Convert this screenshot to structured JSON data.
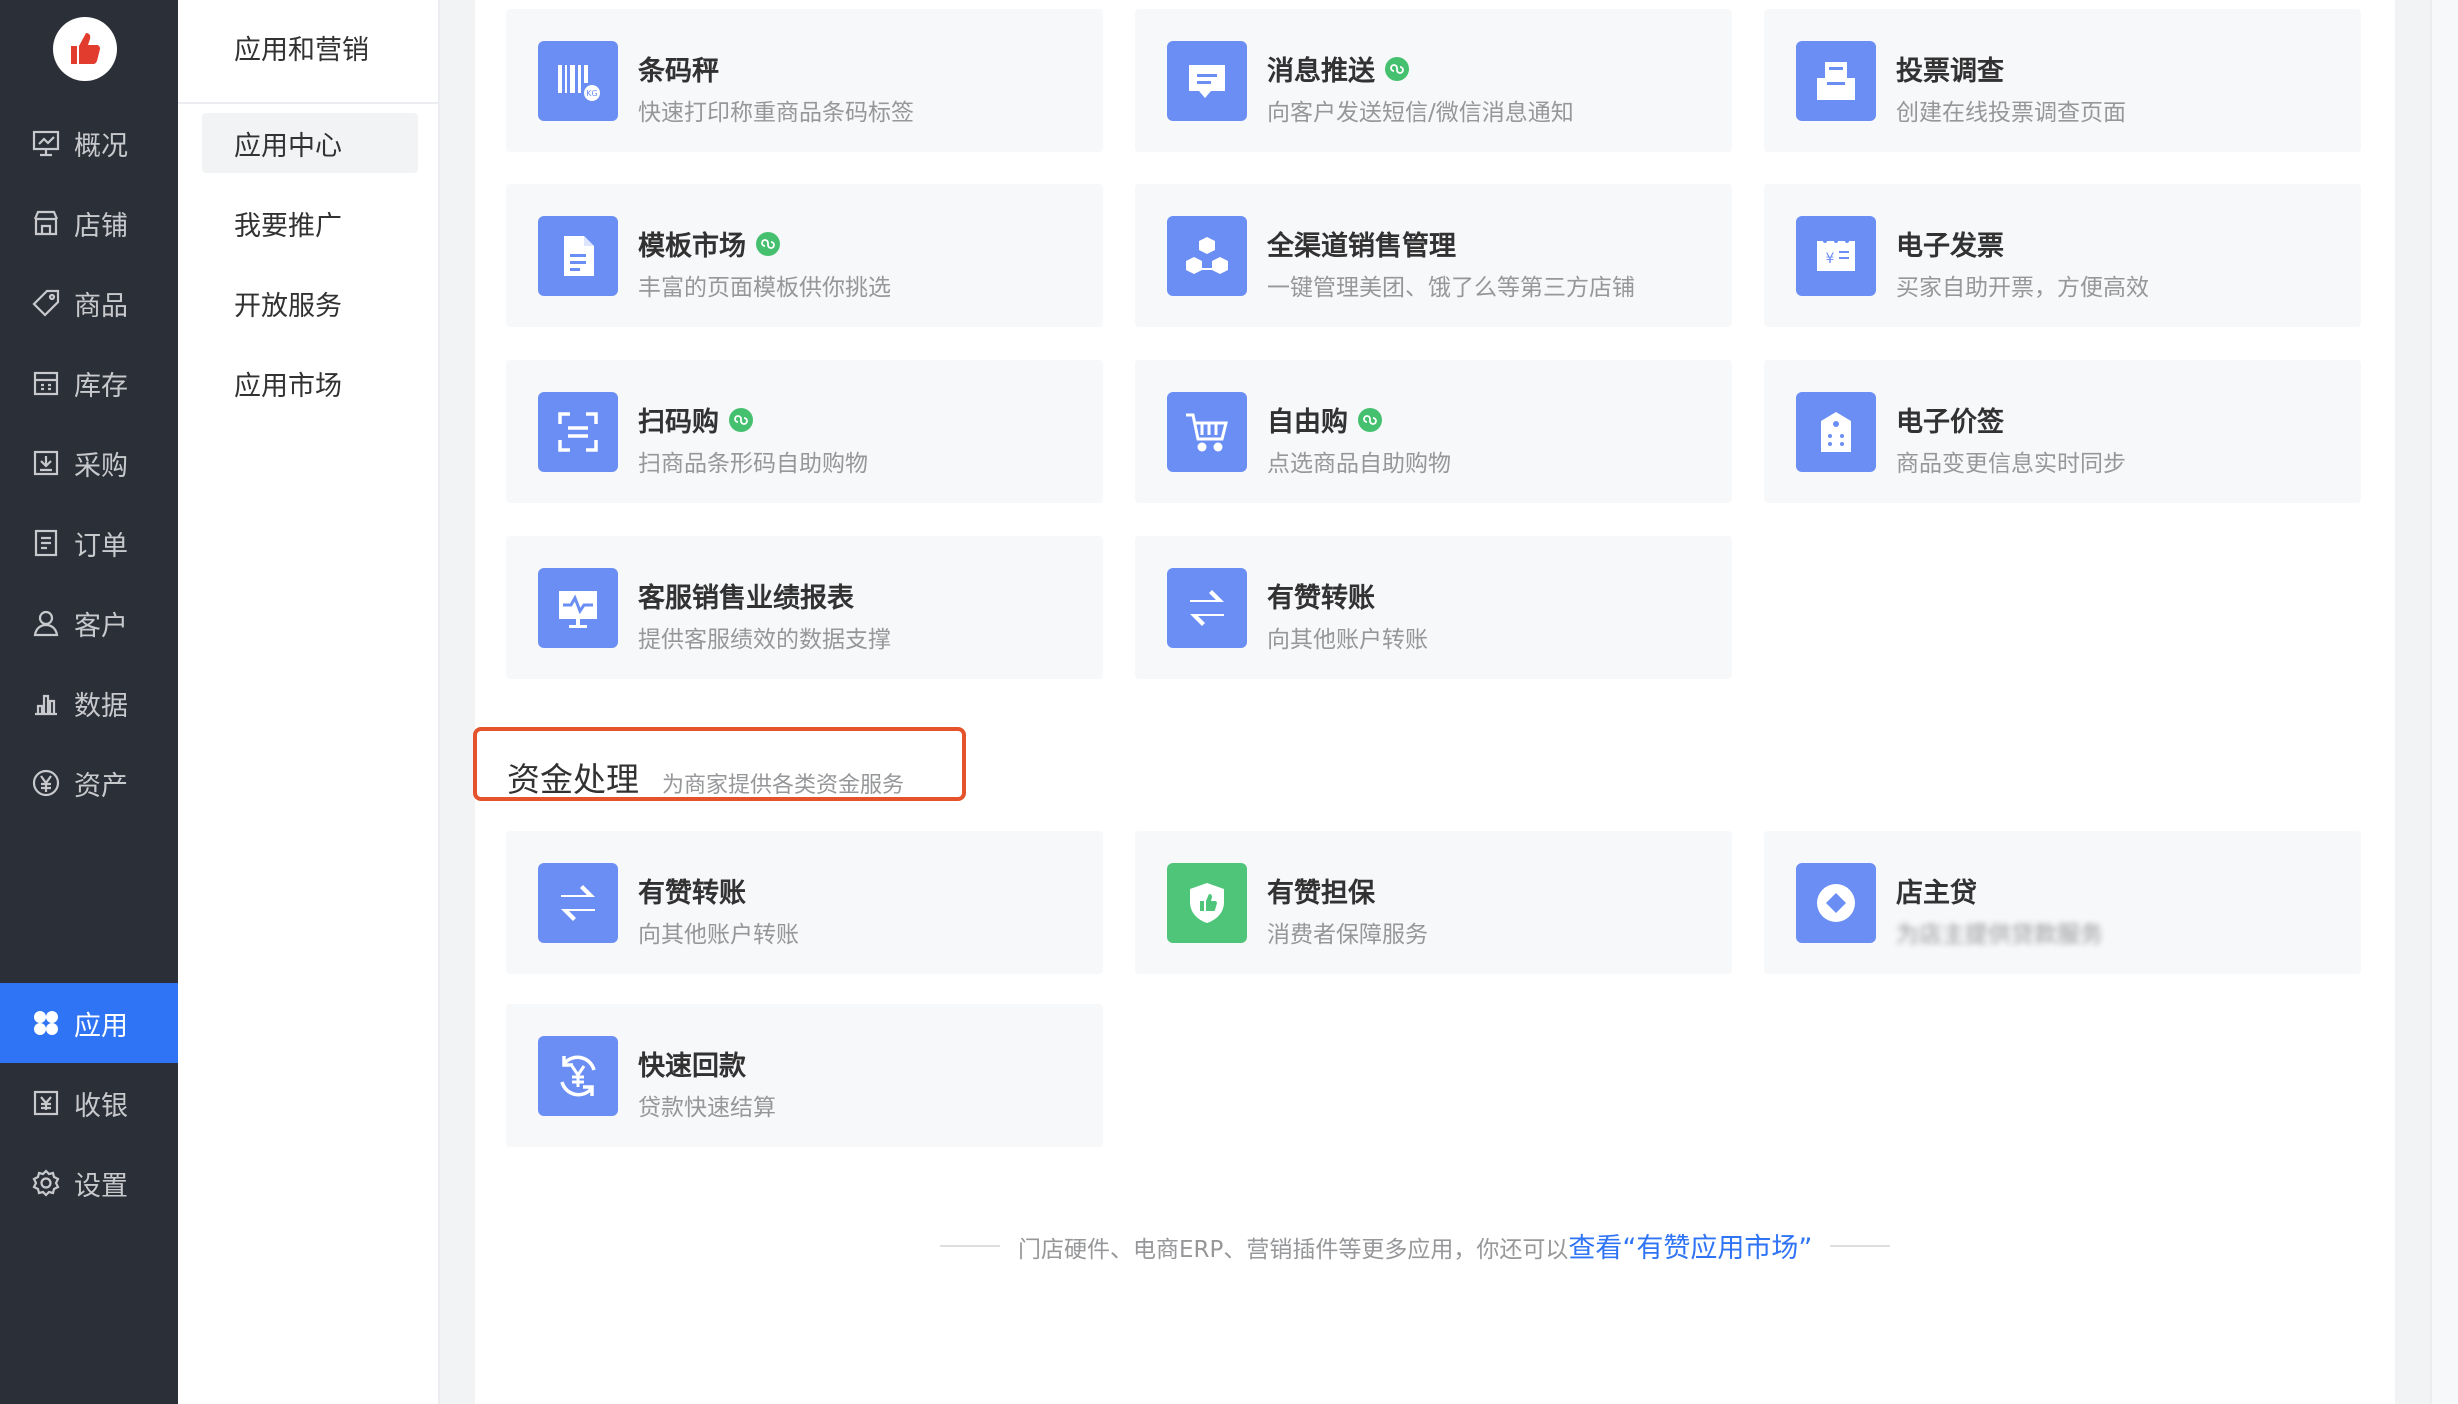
{
  "nav": {
    "items": [
      {
        "label": "概况",
        "icon": "dashboard-icon"
      },
      {
        "label": "店铺",
        "icon": "store-icon"
      },
      {
        "label": "商品",
        "icon": "tag-icon"
      },
      {
        "label": "库存",
        "icon": "inventory-icon"
      },
      {
        "label": "采购",
        "icon": "purchase-icon"
      },
      {
        "label": "订单",
        "icon": "order-icon"
      },
      {
        "label": "客户",
        "icon": "user-icon"
      },
      {
        "label": "数据",
        "icon": "bar-chart-icon"
      },
      {
        "label": "资产",
        "icon": "yuan-circle-icon"
      },
      {
        "label": "应用",
        "icon": "apps-icon",
        "active": true
      },
      {
        "label": "收银",
        "icon": "cashier-icon"
      },
      {
        "label": "设置",
        "icon": "gear-icon"
      }
    ]
  },
  "subnav": {
    "title": "应用和营销",
    "items": [
      {
        "label": "应用中心",
        "active": true
      },
      {
        "label": "我要推广"
      },
      {
        "label": "开放服务"
      },
      {
        "label": "应用市场"
      }
    ]
  },
  "apps": [
    {
      "title": "条码秤",
      "desc": "快速打印称重商品条码标签",
      "icon": "barcode-scale-icon"
    },
    {
      "title": "消息推送",
      "desc": "向客户发送短信/微信消息通知",
      "icon": "message-icon",
      "mini": true
    },
    {
      "title": "投票调查",
      "desc": "创建在线投票调查页面",
      "icon": "vote-box-icon"
    },
    {
      "title": "模板市场",
      "desc": "丰富的页面模板供你挑选",
      "icon": "document-icon",
      "mini": true
    },
    {
      "title": "全渠道销售管理",
      "desc": "一键管理美团、饿了么等第三方店铺",
      "icon": "omnichannel-icon"
    },
    {
      "title": "电子发票",
      "desc": "买家自助开票，方便高效",
      "icon": "invoice-icon"
    },
    {
      "title": "扫码购",
      "desc": "扫商品条形码自助购物",
      "icon": "scan-icon",
      "mini": true
    },
    {
      "title": "自由购",
      "desc": "点选商品自助购物",
      "icon": "cart-icon",
      "mini": true
    },
    {
      "title": "电子价签",
      "desc": "商品变更信息实时同步",
      "icon": "price-tag-icon"
    },
    {
      "title": "客服销售业绩报表",
      "desc": "提供客服绩效的数据支撑",
      "icon": "report-monitor-icon"
    },
    {
      "title": "有赞转账",
      "desc": "向其他账户转账",
      "icon": "transfer-icon"
    }
  ],
  "finance_section": {
    "title": "资金处理",
    "subtitle": "为商家提供各类资金服务",
    "apps": [
      {
        "title": "有赞转账",
        "desc": "向其他账户转账",
        "icon": "transfer-icon"
      },
      {
        "title": "有赞担保",
        "desc": "消费者保障服务",
        "icon": "shield-thumb-icon",
        "color": "#4fc57a"
      },
      {
        "title": "店主贷",
        "desc": "为店主提供贷款服务",
        "icon": "diamond-circle-icon",
        "blurred": true
      },
      {
        "title": "快速回款",
        "desc": "贷款快速结算",
        "icon": "yuan-refresh-icon"
      }
    ]
  },
  "footer": {
    "text": "门店硬件、电商ERP、营销插件等更多应用，你还可以",
    "link": "查看“有赞应用市场”"
  },
  "colors": {
    "nav_bg": "#2b2f38",
    "active_blue": "#2f74f5",
    "icon_blue": "#6b8ef5",
    "icon_green": "#4fc57a",
    "highlight_red": "#e4532b"
  }
}
